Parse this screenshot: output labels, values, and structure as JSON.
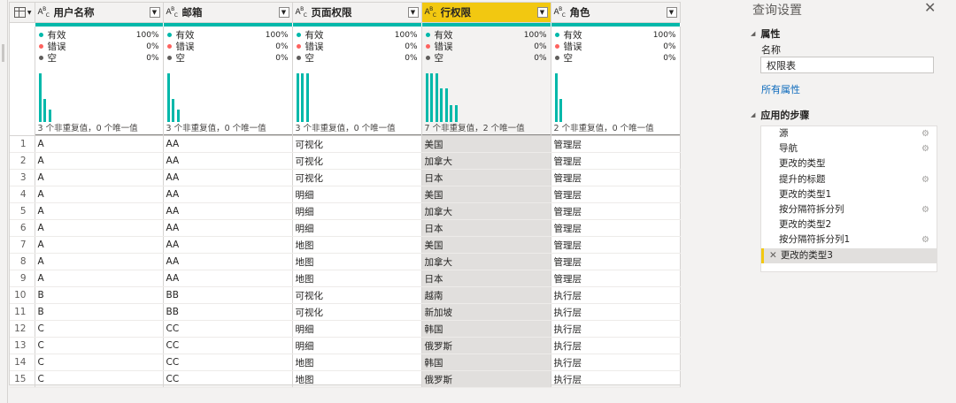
{
  "editor": {
    "columns": [
      {
        "name": "用户名称",
        "type_icon": "ABC",
        "selected": false,
        "valid_label": "有效",
        "valid_pct": "100%",
        "error_label": "错误",
        "error_pct": "0%",
        "empty_label": "空",
        "empty_pct": "0%",
        "distinct_text": "3 个非重复值，0 个唯一值",
        "histogram": [
          0.95,
          0.45,
          0.24
        ]
      },
      {
        "name": "邮箱",
        "type_icon": "ABC",
        "selected": false,
        "valid_label": "有效",
        "valid_pct": "100%",
        "error_label": "错误",
        "error_pct": "0%",
        "empty_label": "空",
        "empty_pct": "0%",
        "distinct_text": "3 个非重复值，0 个唯一值",
        "histogram": [
          0.95,
          0.45,
          0.24
        ]
      },
      {
        "name": "页面权限",
        "type_icon": "ABC",
        "selected": false,
        "valid_label": "有效",
        "valid_pct": "100%",
        "error_label": "错误",
        "error_pct": "0%",
        "empty_label": "空",
        "empty_pct": "0%",
        "distinct_text": "3 个非重复值，0 个唯一值",
        "histogram": [
          0.95,
          0.95,
          0.95
        ]
      },
      {
        "name": "行权限",
        "type_icon": "ABC",
        "selected": true,
        "valid_label": "有效",
        "valid_pct": "100%",
        "error_label": "错误",
        "error_pct": "0%",
        "empty_label": "空",
        "empty_pct": "0%",
        "distinct_text": "7 个非重复值，2 个唯一值",
        "histogram": [
          0.95,
          0.95,
          0.95,
          0.65,
          0.65,
          0.33,
          0.33
        ]
      },
      {
        "name": "角色",
        "type_icon": "ABC",
        "selected": false,
        "valid_label": "有效",
        "valid_pct": "100%",
        "error_label": "错误",
        "error_pct": "0%",
        "empty_label": "空",
        "empty_pct": "0%",
        "distinct_text": "2 个非重复值，0 个唯一值",
        "histogram": [
          0.95,
          0.45
        ]
      }
    ],
    "rows": [
      [
        "1",
        "A",
        "AA",
        "可视化",
        "美国",
        "管理层"
      ],
      [
        "2",
        "A",
        "AA",
        "可视化",
        "加拿大",
        "管理层"
      ],
      [
        "3",
        "A",
        "AA",
        "可视化",
        "日本",
        "管理层"
      ],
      [
        "4",
        "A",
        "AA",
        "明细",
        "美国",
        "管理层"
      ],
      [
        "5",
        "A",
        "AA",
        "明细",
        "加拿大",
        "管理层"
      ],
      [
        "6",
        "A",
        "AA",
        "明细",
        "日本",
        "管理层"
      ],
      [
        "7",
        "A",
        "AA",
        "地图",
        "美国",
        "管理层"
      ],
      [
        "8",
        "A",
        "AA",
        "地图",
        "加拿大",
        "管理层"
      ],
      [
        "9",
        "A",
        "AA",
        "地图",
        "日本",
        "管理层"
      ],
      [
        "10",
        "B",
        "BB",
        "可视化",
        "越南",
        "执行层"
      ],
      [
        "11",
        "B",
        "BB",
        "可视化",
        "新加坡",
        "执行层"
      ],
      [
        "12",
        "C",
        "CC",
        "明细",
        "韩国",
        "执行层"
      ],
      [
        "13",
        "C",
        "CC",
        "明细",
        "俄罗斯",
        "执行层"
      ],
      [
        "14",
        "C",
        "CC",
        "地图",
        "韩国",
        "执行层"
      ],
      [
        "15",
        "C",
        "CC",
        "地图",
        "俄罗斯",
        "执行层"
      ]
    ],
    "colors": {
      "profile_bar": "#01b8aa",
      "valid_dot": "#01b8aa",
      "error_dot": "#fd625e",
      "empty_dot": "#605e5c",
      "selected_header": "#f2c811"
    }
  },
  "query_settings": {
    "title": "查询设置",
    "close_icon": "close-icon",
    "properties_header": "属性",
    "name_label": "名称",
    "name_value": "权限表",
    "all_properties_link": "所有属性",
    "applied_steps_header": "应用的步骤",
    "steps": [
      {
        "label": "源",
        "has_gear": true,
        "selected": false
      },
      {
        "label": "导航",
        "has_gear": true,
        "selected": false
      },
      {
        "label": "更改的类型",
        "has_gear": false,
        "selected": false
      },
      {
        "label": "提升的标题",
        "has_gear": true,
        "selected": false
      },
      {
        "label": "更改的类型1",
        "has_gear": false,
        "selected": false
      },
      {
        "label": "按分隔符拆分列",
        "has_gear": true,
        "selected": false
      },
      {
        "label": "更改的类型2",
        "has_gear": false,
        "selected": false
      },
      {
        "label": "按分隔符拆分列1",
        "has_gear": true,
        "selected": false
      },
      {
        "label": "更改的类型3",
        "has_gear": false,
        "selected": true
      }
    ]
  }
}
